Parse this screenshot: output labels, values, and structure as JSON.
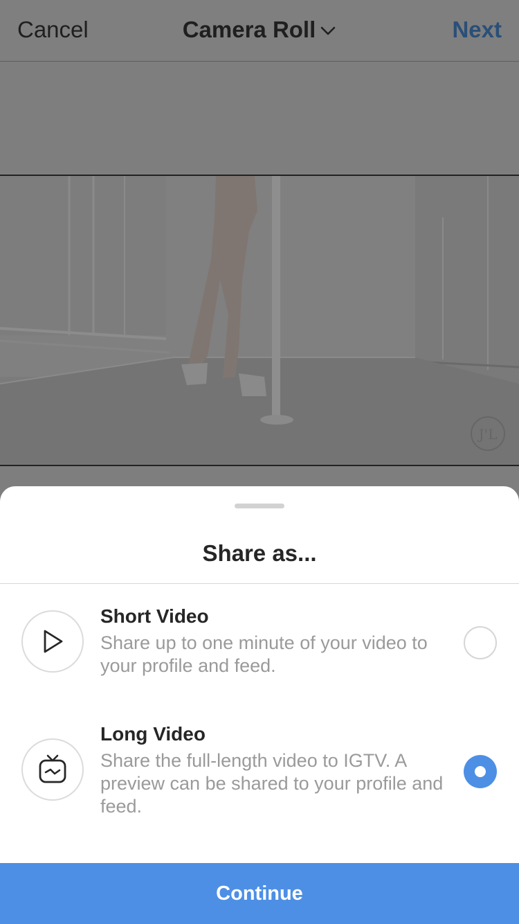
{
  "nav": {
    "cancel_label": "Cancel",
    "title": "Camera Roll",
    "next_label": "Next",
    "title_icon": "chevron-down-icon"
  },
  "sheet": {
    "title": "Share as...",
    "options": [
      {
        "title": "Short Video",
        "description": "Share up to one minute of your video to your profile and feed.",
        "icon": "play-icon",
        "selected": false
      },
      {
        "title": "Long Video",
        "description": "Share the full-length video to IGTV. A preview can be shared to your profile and feed.",
        "icon": "igtv-icon",
        "selected": true
      }
    ],
    "continue_label": "Continue"
  },
  "colors": {
    "accent": "#4d8fe5",
    "next_dimmed": "#2a4f78",
    "overlay": "#7e7e7e"
  }
}
